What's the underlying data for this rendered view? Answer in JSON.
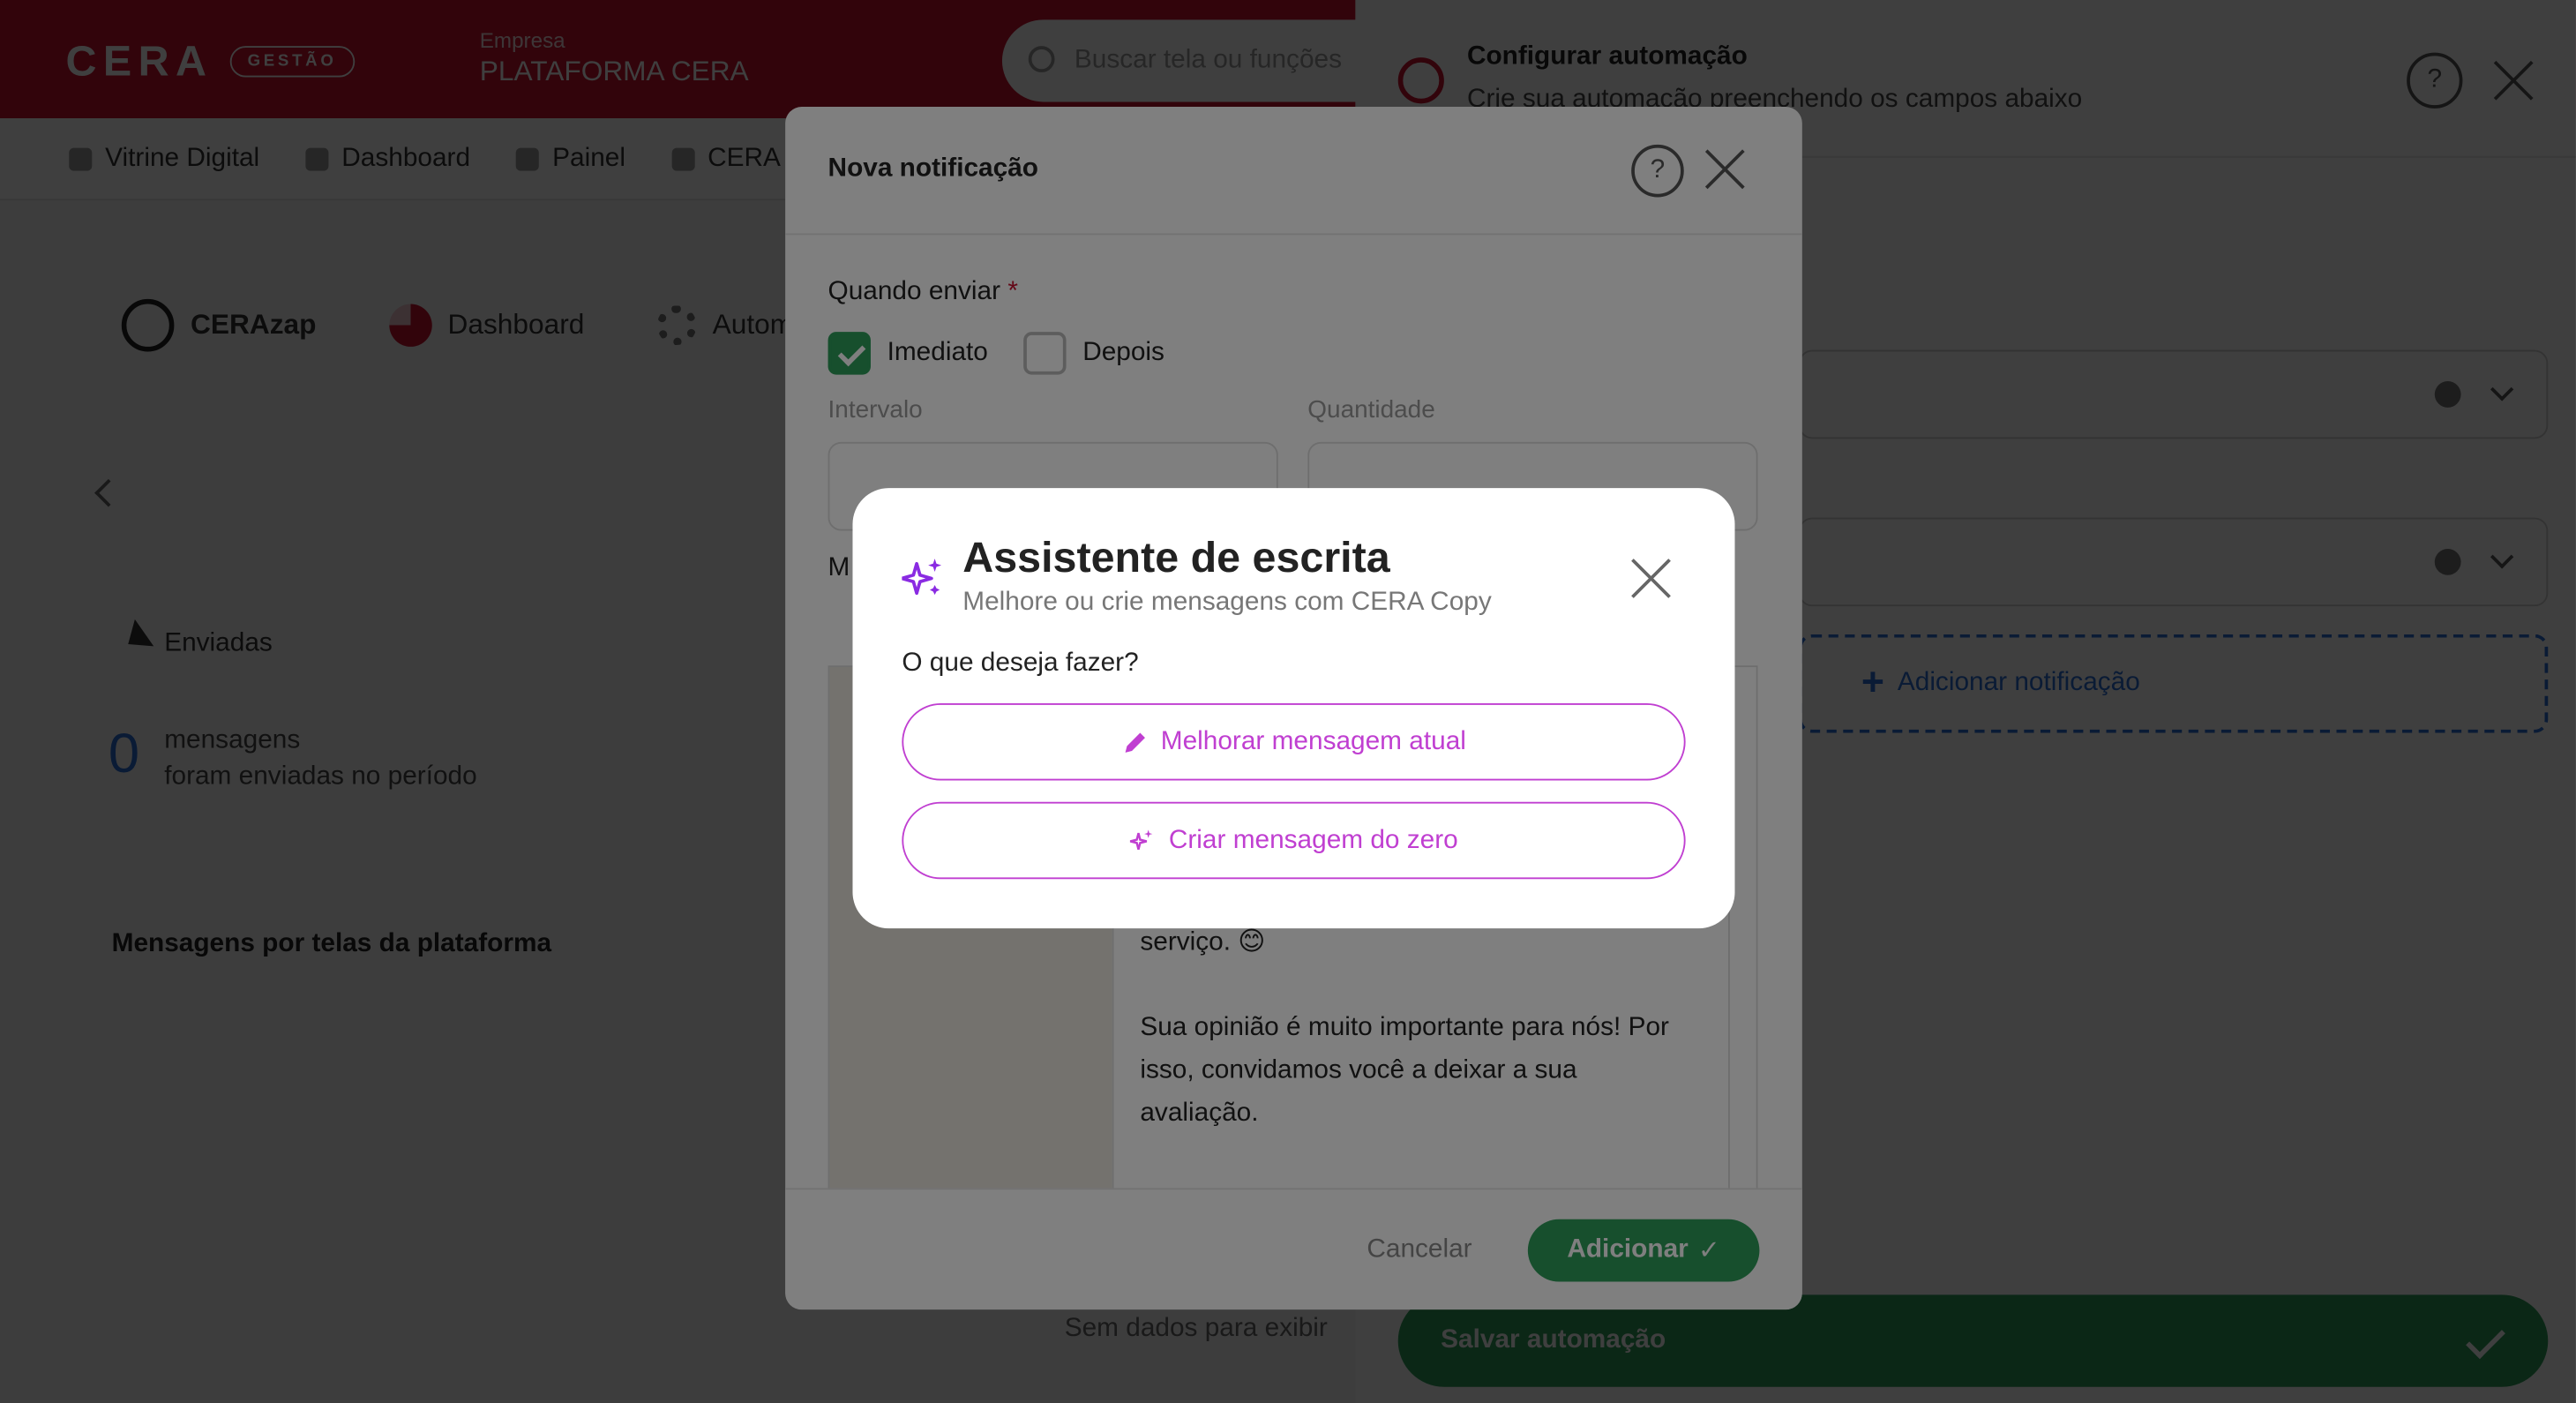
{
  "header": {
    "logo_text": "CERA",
    "logo_badge": "GESTÃO",
    "company_label": "Empresa",
    "company_name": "PLATAFORMA CERA",
    "search_placeholder": "Buscar tela ou funções"
  },
  "nav": {
    "items": [
      {
        "label": "Vitrine Digital"
      },
      {
        "label": "Dashboard"
      },
      {
        "label": "Painel"
      },
      {
        "label": "CERA"
      }
    ]
  },
  "subnav": {
    "cerazap": "CERAzap",
    "dashboard": "Dashboard",
    "automations": "Automações"
  },
  "stats": {
    "sent_label": "Enviadas",
    "count": "0",
    "count_line1": "mensagens",
    "count_line2": "foram enviadas no período"
  },
  "chart_section": {
    "title": "Mensagens por telas da plataforma",
    "empty": "Sem dados para exibir"
  },
  "side_panel": {
    "title": "Configurar automação",
    "subtitle": "Crie sua automação preenchendo os campos abaixo",
    "help": "?",
    "add_notification": "Adicionar notificação",
    "save_button": "Salvar automação"
  },
  "notification_modal": {
    "title": "Nova notificação",
    "help": "?",
    "when_label": "Quando enviar",
    "required_mark": "*",
    "option_immediate": "Imediato",
    "option_later": "Depois",
    "interval_label": "Intervalo",
    "quantity_label": "Quantidade",
    "message_label": "M",
    "message_text_1": "serviço. 😊",
    "message_text_2": "Sua opinião é muito importante para nós! Por isso, convidamos você a deixar a sua avaliação.",
    "cancel": "Cancelar",
    "add": "Adicionar"
  },
  "assistant_dialog": {
    "title": "Assistente de escrita",
    "subtitle": "Melhore ou crie mensagens com CERA Copy",
    "question": "O que deseja fazer?",
    "option_improve": "Melhorar mensagem atual",
    "option_create": "Criar mensagem do zero",
    "accent_color": "#c03fd1",
    "icon_color": "#8a2be2"
  }
}
